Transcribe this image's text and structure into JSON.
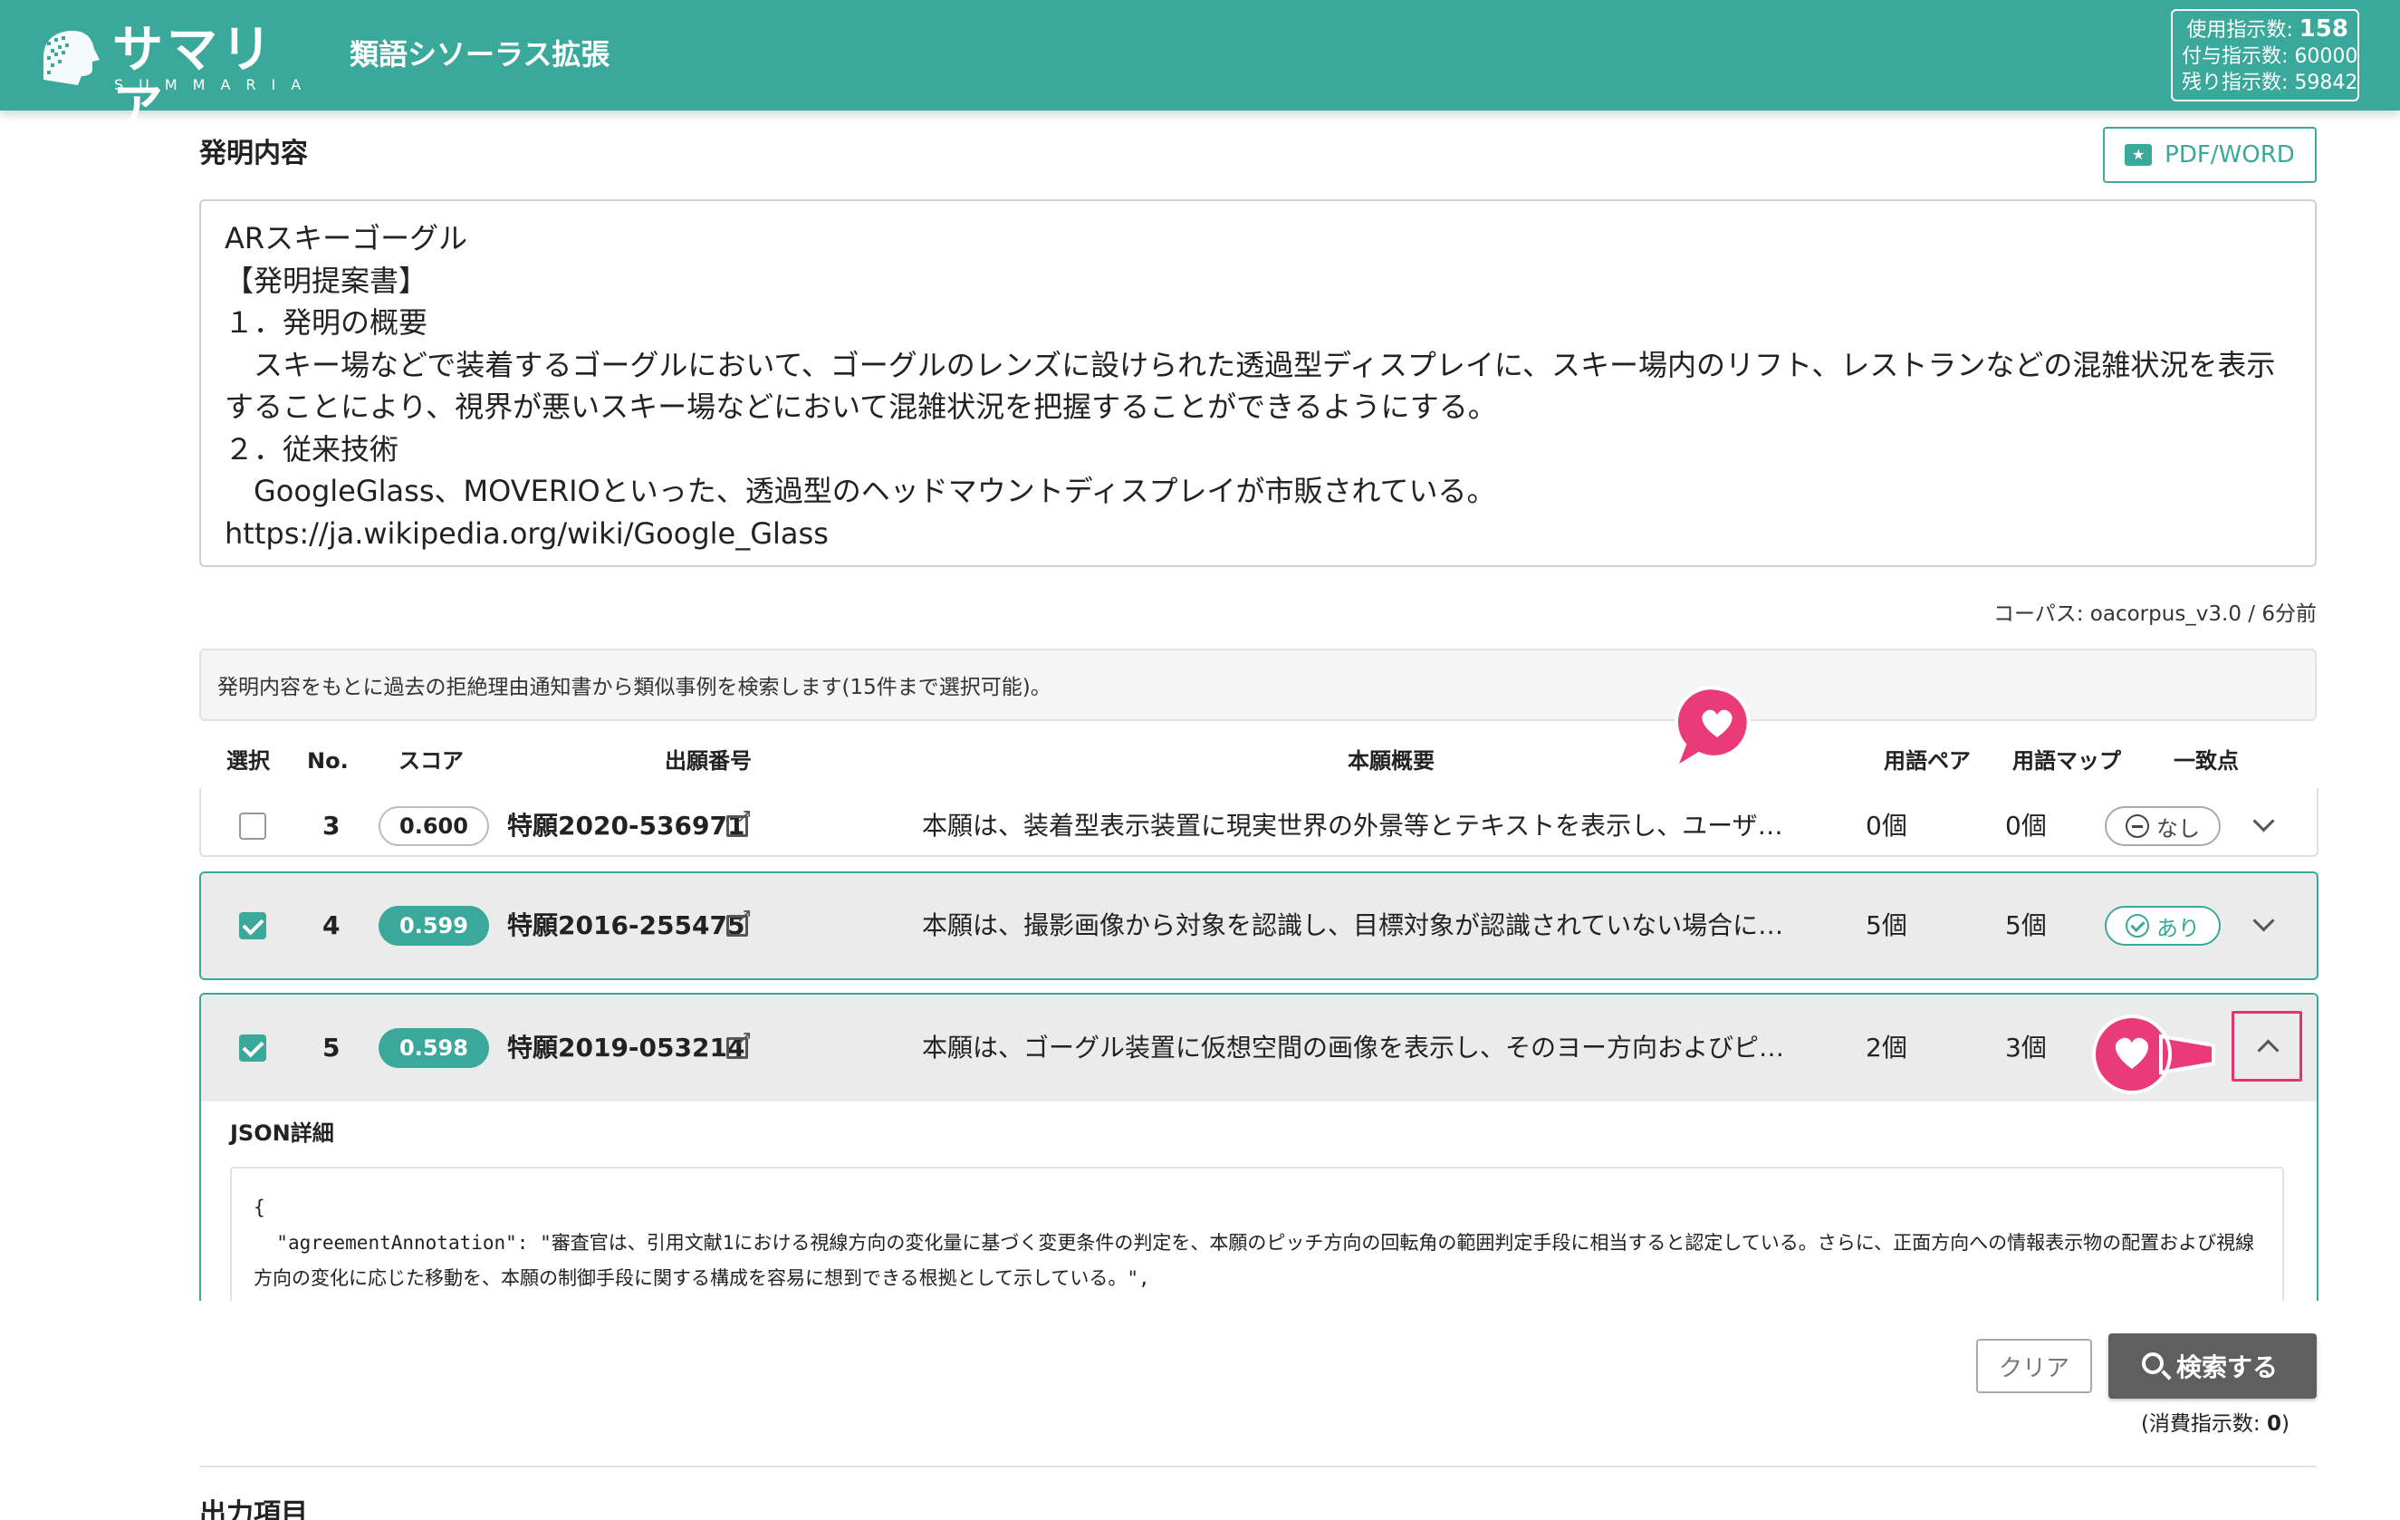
{
  "header": {
    "logo_text": "サマリア",
    "logo_sub": "SUMMARIA",
    "app_title": "類語シソーラス拡張",
    "usage": {
      "used_label": "使用指示数: ",
      "used_value": "158",
      "granted_label": "付与指示数: ",
      "granted_value": "60000",
      "remaining_label": "残り指示数: ",
      "remaining_value": "59842"
    }
  },
  "invention": {
    "title": "発明内容",
    "pdf_button": "PDF/WORD",
    "text": "ARスキーゴーグル\n【発明提案書】\n１．発明の概要\n　スキー場などで装着するゴーグルにおいて、ゴーグルのレンズに設けられた透過型ディスプレイに、スキー場内のリフト、レストランなどの混雑状況を表示することにより、視界が悪いスキー場などにおいて混雑状況を把握することができるようにする。\n２．従来技術\n　GoogleGlass、MOVERIOといった、透過型のヘッドマウントディスプレイが市販されている。\nhttps://ja.wikipedia.org/wiki/Google_Glass",
    "corpus": "コーパス: oacorpus_v3.0 / 6分前",
    "info": "発明内容をもとに過去の拒絶理由通知書から類似事例を検索します(15件まで選択可能)。"
  },
  "table": {
    "headers": {
      "select": "選択",
      "no": "No.",
      "score": "スコア",
      "app_no": "出願番号",
      "summary": "本願概要",
      "term_pair": "用語ペア",
      "term_map": "用語マップ",
      "match": "一致点"
    },
    "rows": [
      {
        "checked": false,
        "no": "3",
        "score": "0.600",
        "app_no": "特願2020-536971",
        "summary": "本願は、装着型表示装置に現実世界の外景等とテキストを表示し、ユーザ…",
        "term_pair": "0個",
        "term_map": "0個",
        "match": "なし"
      },
      {
        "checked": true,
        "no": "4",
        "score": "0.599",
        "app_no": "特願2016-255475",
        "summary": "本願は、撮影画像から対象を認識し、目標対象が認識されていない場合に…",
        "term_pair": "5個",
        "term_map": "5個",
        "match": "あり"
      },
      {
        "checked": true,
        "no": "5",
        "score": "0.598",
        "app_no": "特願2019-053214",
        "summary": "本願は、ゴーグル装置に仮想空間の画像を表示し、そのヨー方向およびピ…",
        "term_pair": "2個",
        "term_map": "3個",
        "match": ""
      }
    ],
    "json_label": "JSON詳細",
    "json_text": "{\n  \"agreementAnnotation\": \"審査官は、引用文献1における視線方向の変化量に基づく変更条件の判定を、本願のピッチ方向の回転角の範囲判定手段に相当すると認定している。さらに、正面方向への情報表示物の配置および視線方向の変化に応じた移動を、本願の制御手段に関する構成を容易に想到できる根拠として示している。\","
  },
  "actions": {
    "clear": "クリア",
    "search": "検索する",
    "consume_label": "(消費指示数: ",
    "consume_value": "0",
    "consume_end": ")"
  },
  "output": {
    "title": "出力項目"
  },
  "colors": {
    "brand": "#3aa89a",
    "highlight": "#e8336e",
    "search_button": "#5f5f5f"
  }
}
